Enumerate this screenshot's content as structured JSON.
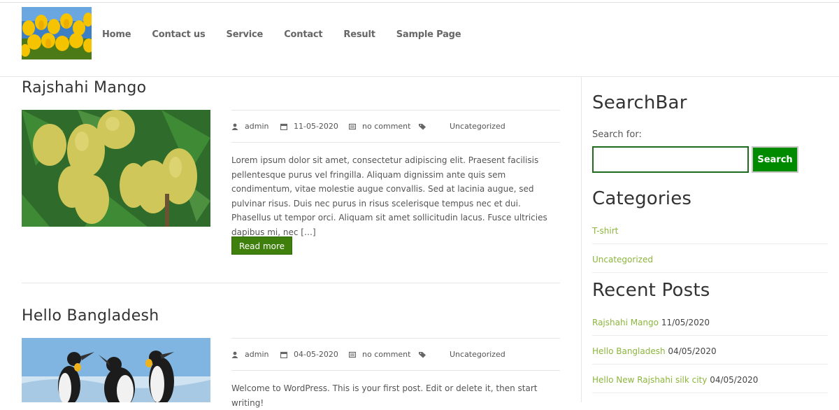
{
  "nav": [
    "Home",
    "Contact us",
    "Service",
    "Contact",
    "Result",
    "Sample Page"
  ],
  "posts": [
    {
      "title": "Rajshahi Mango",
      "author": "admin",
      "date": "11-05-2020",
      "comments": "no comment",
      "category": "Uncategorized",
      "excerpt": "Lorem ipsum dolor sit amet, consectetur adipiscing elit. Praesent facilisis pellentesque purus vel fringilla. Aliquam dignissim ante quis sem condimentum, vitae molestie augue convallis. Sed at lacinia augue, sed pulvinar risus. Duis nec purus in risus scelerisque tempus nec et dui. Phasellus ut tempor orci. Aliquam sit amet sollicitudin lacus. Fusce ultricies dapibus mi, nec […]",
      "read_more": "Read more"
    },
    {
      "title": "Hello Bangladesh",
      "author": "admin",
      "date": "04-05-2020",
      "comments": "no comment",
      "category": "Uncategorized",
      "excerpt": "Welcome to WordPress. This is your first post. Edit or delete it, then start writing!"
    }
  ],
  "sidebar": {
    "search_title": "SearchBar",
    "search_label": "Search for:",
    "search_value": "",
    "search_button": "Search",
    "categories_title": "Categories",
    "categories": [
      "T-shirt",
      "Uncategorized"
    ],
    "recent_title": "Recent Posts",
    "recent": [
      {
        "title": "Rajshahi Mango",
        "date": "11/05/2020"
      },
      {
        "title": "Hello Bangladesh",
        "date": "04/05/2020"
      },
      {
        "title": "Hello New Rajshahi silk city",
        "date": "04/05/2020"
      }
    ]
  },
  "colors": {
    "accent_green": "#3f7f0c",
    "link_green": "#8cb53c",
    "search_border": "#1e6b1e"
  }
}
